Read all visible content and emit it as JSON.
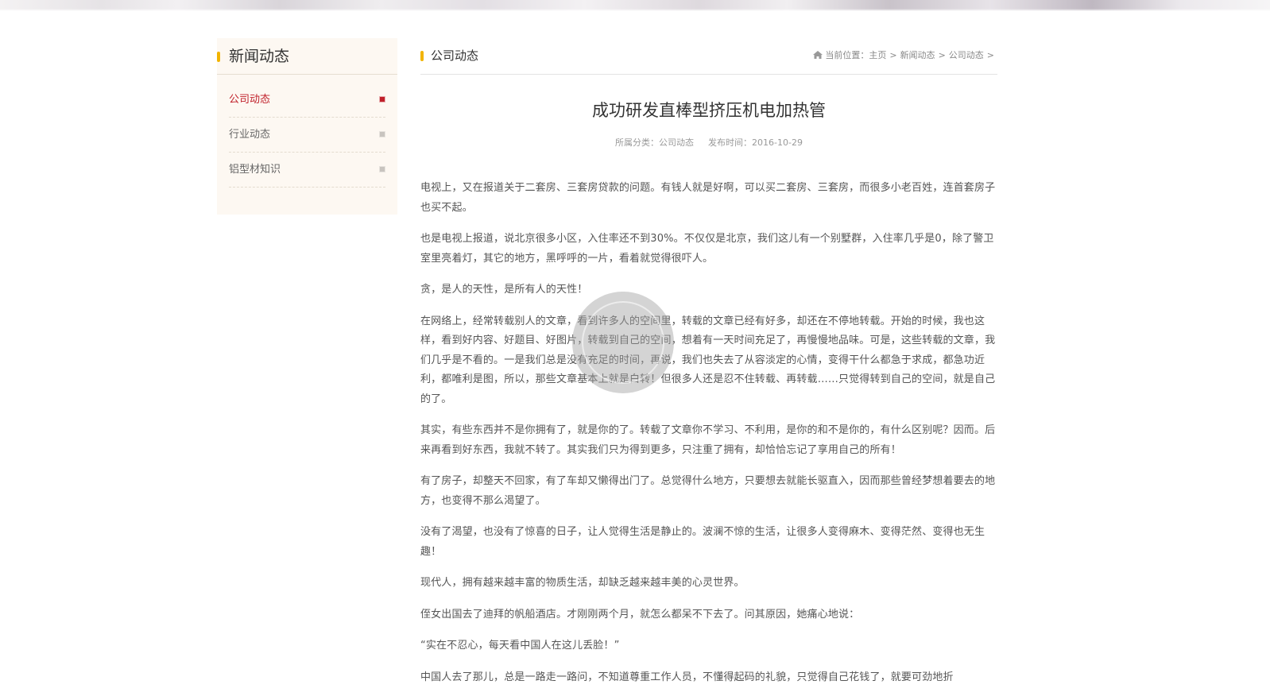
{
  "sidebar": {
    "title": "新闻动态",
    "items": [
      {
        "label": "公司动态"
      },
      {
        "label": "行业动态"
      },
      {
        "label": "铝型材知识"
      }
    ]
  },
  "main": {
    "section_title": "公司动态",
    "breadcrumb": {
      "prefix": "当前位置：",
      "items": [
        "主页",
        "新闻动态",
        "公司动态"
      ],
      "separator": ">"
    }
  },
  "article": {
    "title": "成功研发直棒型挤压机电加热管",
    "category": "所属分类：公司动态",
    "date": "发布时间：2016-10-29",
    "paragraphs": [
      "电视上，又在报道关于二套房、三套房贷款的问题。有钱人就是好啊，可以买二套房、三套房，而很多小老百姓，连首套房子也买不起。",
      "也是电视上报道，说北京很多小区，入住率还不到30%。不仅仅是北京，我们这儿有一个别墅群，入住率几乎是0，除了警卫室里亮着灯，其它的地方，黑呼呼的一片，看着就觉得很吓人。",
      "贪，是人的天性，是所有人的天性！",
      "在网络上，经常转载别人的文章，看到许多人的空间里，转载的文章已经有好多，却还在不停地转载。开始的时候，我也这样，看到好内容、好题目、好图片，转载到自己的空间，想着有一天时间充足了，再慢慢地品味。可是，这些转载的文章，我们几乎是不看的。一是我们总是没有充足的时间，再说，我们也失去了从容淡定的心情，变得干什么都急于求成，都急功近利，都唯利是图，所以，那些文章基本上就是白转！但很多人还是忍不住转载、再转载……只觉得转到自己的空间，就是自己的了。",
      "其实，有些东西并不是你拥有了，就是你的了。转载了文章你不学习、不利用，是你的和不是你的，有什么区别呢？因而。后来再看到好东西，我就不转了。其实我们只为得到更多，只注重了拥有，却恰恰忘记了享用自己的所有！",
      "有了房子，却整天不回家，有了车却又懒得出门了。总觉得什么地方，只要想去就能长驱直入，因而那些曾经梦想着要去的地方，也变得不那么渴望了。",
      "没有了渴望，也没有了惊喜的日子，让人觉得生活是静止的。波澜不惊的生活，让很多人变得麻木、变得茫然、变得也无生趣！",
      "现代人，拥有越来越丰富的物质生活，却缺乏越来越丰美的心灵世界。",
      "侄女出国去了迪拜的帆船酒店。才刚刚两个月，就怎么都呆不下去了。问其原因，她痛心地说：",
      "“实在不忍心，每天看中国人在这儿丢脸！”",
      "中国人去了那儿，总是一路走一路问，不知道尊重工作人员，不懂得起码的礼貌，只觉得自己花钱了，就要可劲地折"
    ]
  },
  "colors": {
    "accent_bar": "#f2b400",
    "active_link": "#c0202a",
    "sidebar_bg": "#fdf8f2"
  }
}
